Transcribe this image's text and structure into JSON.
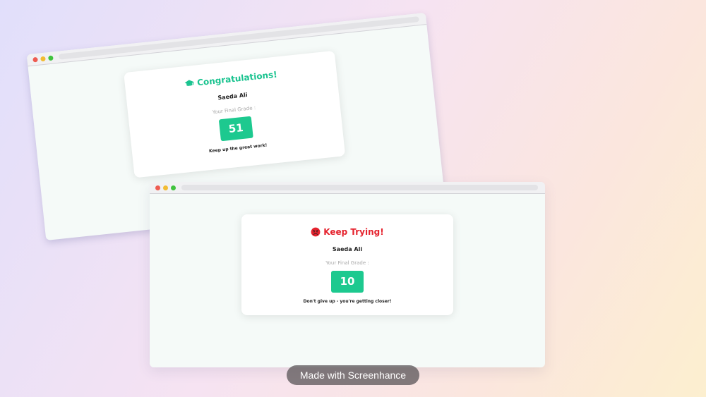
{
  "windows": [
    {
      "card": {
        "title": "Congratulations!",
        "icon": "graduation-cap-icon",
        "student_name": "Saeda Ali",
        "grade_label": "Your Final Grade :",
        "grade": "51",
        "message": "Keep up the great work!"
      }
    },
    {
      "card": {
        "title": "Keep Trying!",
        "icon": "sad-face-icon",
        "student_name": "Saeda Ali",
        "grade_label": "Your Final Grade :",
        "grade": "10",
        "message": "Don't give up - you're getting closer!"
      }
    }
  ],
  "watermark": "Made with Screenhance",
  "colors": {
    "success": "#19c38f",
    "fail": "#e5232e",
    "grade_box": "#1dc98f"
  }
}
